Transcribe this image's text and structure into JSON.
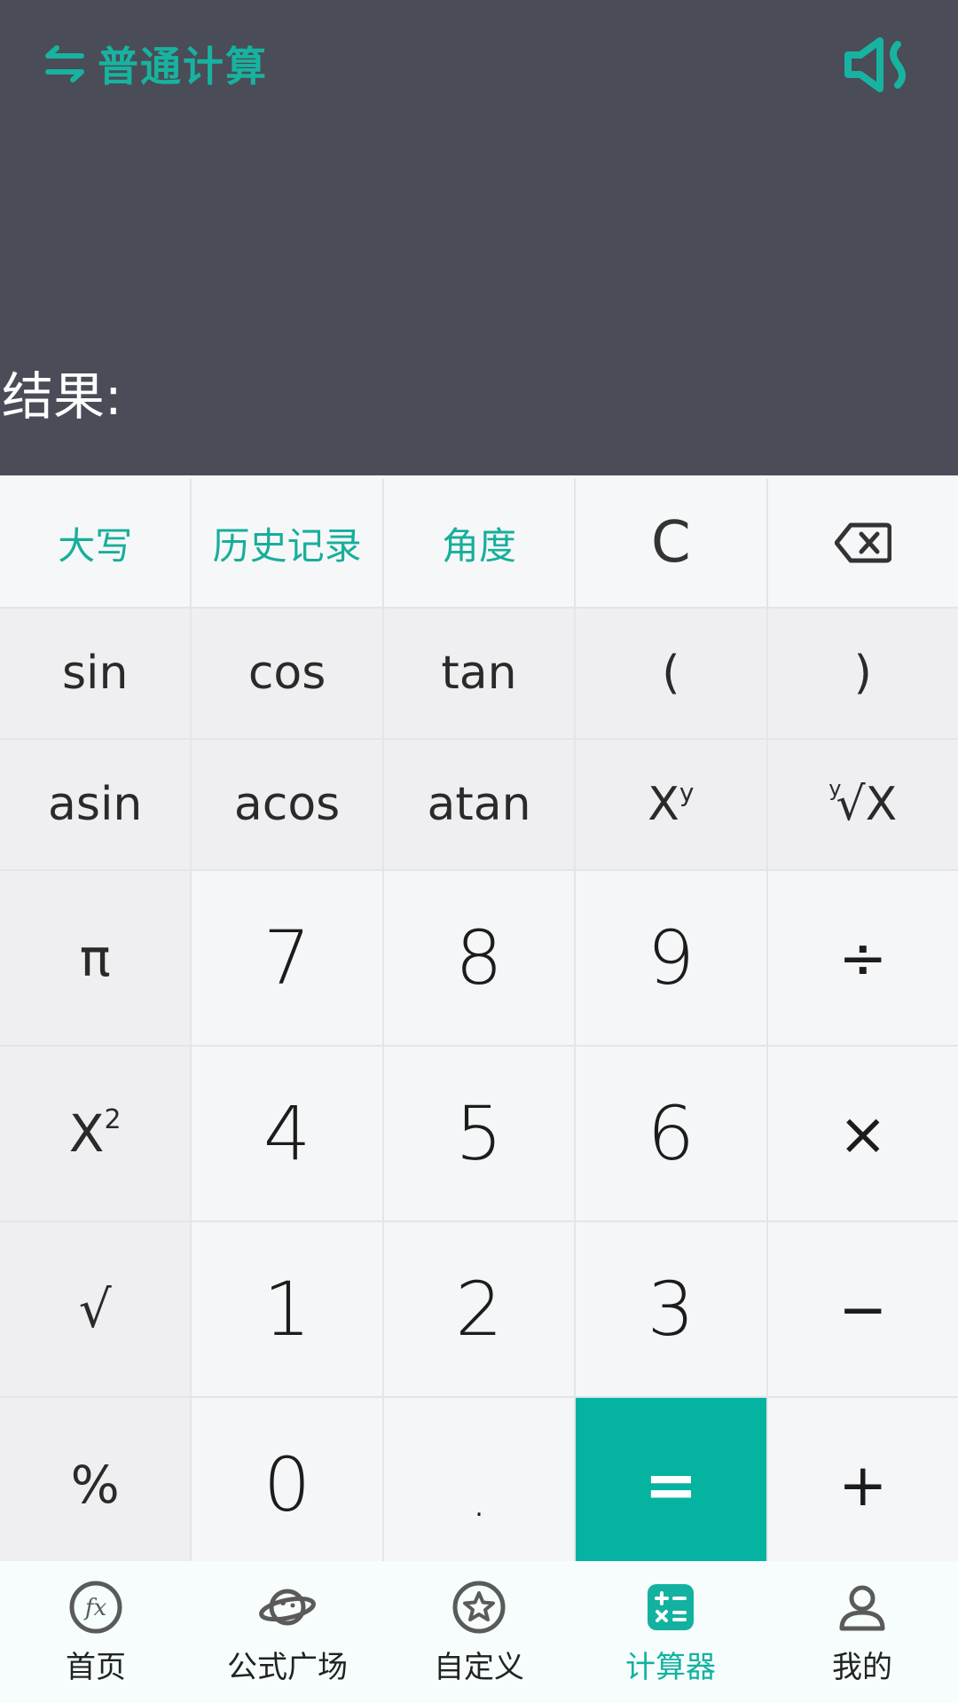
{
  "header": {
    "mode_label": "普通计算",
    "result_label": "结果:",
    "result_value": "",
    "mode_icon": "swap-arrows-icon",
    "sound_icon": "sound-off-icon"
  },
  "colors": {
    "accent": "#05b3a1",
    "display_bg": "#4a4c57"
  },
  "keys": {
    "caps": "大写",
    "history": "历史记录",
    "angle": "角度",
    "clear": "C",
    "backspace_icon": "backspace-icon",
    "sin": "sin",
    "cos": "cos",
    "tan": "tan",
    "lparen": "(",
    "rparen": ")",
    "asin": "asin",
    "acos": "acos",
    "atan": "atan",
    "power_base": "X",
    "power_exp": "y",
    "root_index": "y",
    "root_base": "√X",
    "pi": "π",
    "square_base": "X",
    "square_exp": "2",
    "sqrt": "√",
    "percent": "%",
    "n7": "7",
    "n8": "8",
    "n9": "9",
    "n4": "4",
    "n5": "5",
    "n6": "6",
    "n1": "1",
    "n2": "2",
    "n3": "3",
    "n0": "0",
    "dot": ".",
    "equals": "=",
    "divide": "÷",
    "multiply": "×",
    "minus": "−",
    "plus": "+"
  },
  "nav": {
    "items": [
      {
        "label": "首页",
        "icon": "fx-icon"
      },
      {
        "label": "公式广场",
        "icon": "planet-icon"
      },
      {
        "label": "自定义",
        "icon": "star-badge-icon"
      },
      {
        "label": "计算器",
        "icon": "calculator-icon"
      },
      {
        "label": "我的",
        "icon": "user-icon"
      }
    ],
    "active_index": 3
  }
}
